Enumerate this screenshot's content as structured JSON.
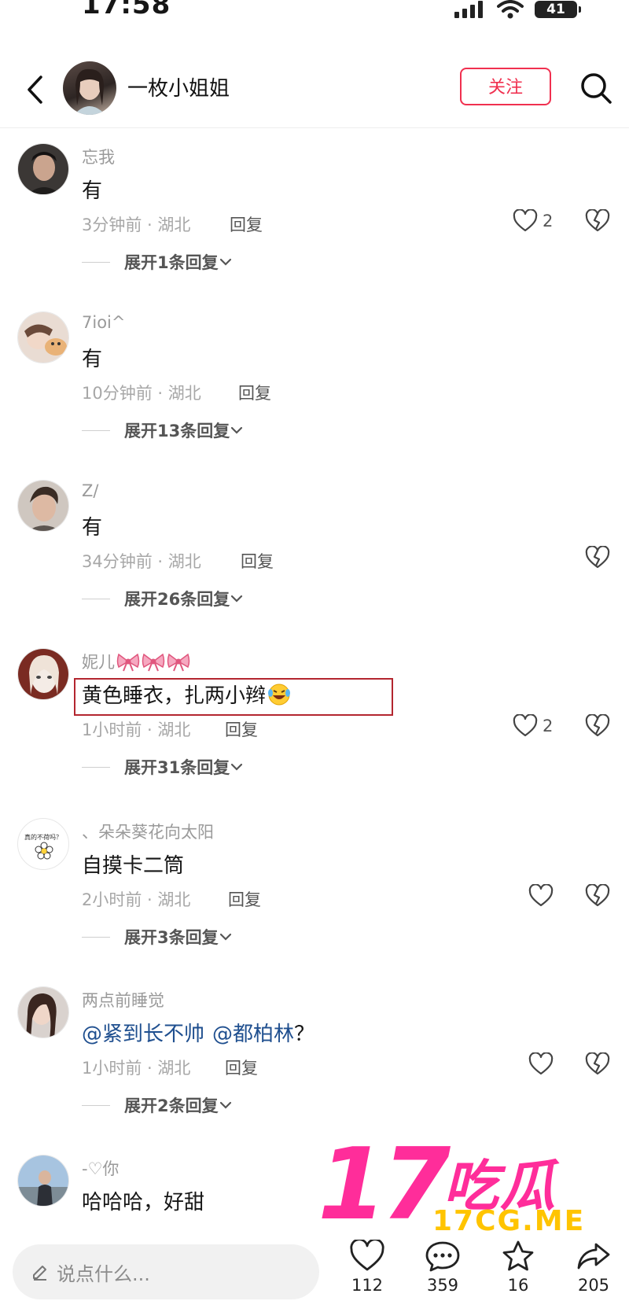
{
  "status_bar": {
    "time": "17:58",
    "battery": "41"
  },
  "header": {
    "title": "一枚小姐姐",
    "follow_label": "关注"
  },
  "comments": [
    {
      "user": "忘我",
      "text": "有",
      "time_location": "3分钟前 · 湖北",
      "reply_label": "回复",
      "likes": "2",
      "expand": "展开1条回复"
    },
    {
      "user": "7ioi^",
      "text": "有",
      "time_location": "10分钟前 · 湖北",
      "reply_label": "回复",
      "likes": "",
      "expand": "展开13条回复"
    },
    {
      "user": "Z/",
      "text": "有",
      "time_location": "34分钟前 · 湖北",
      "reply_label": "回复",
      "likes": "",
      "expand": "展开26条回复"
    },
    {
      "user": "妮儿",
      "text": "黄色睡衣，扎两小辫",
      "time_location": "1小时前 · 湖北",
      "reply_label": "回复",
      "likes": "2",
      "expand": "展开31条回复"
    },
    {
      "user": "、朵朵葵花向太阳",
      "avatar_text": "真的不荷吗？",
      "text": "自摸卡二筒",
      "time_location": "2小时前 · 湖北",
      "reply_label": "回复",
      "likes": "",
      "expand": "展开3条回复"
    },
    {
      "user": "两点前睡觉",
      "text_mention1": "@紧到长不帅",
      "text_mention2": "@都柏林",
      "text_suffix": "？",
      "time_location": "1小时前 · 湖北",
      "reply_label": "回复",
      "likes": "",
      "expand": "展开2条回复"
    },
    {
      "user": "-♡你",
      "text": "哈哈哈，好甜"
    }
  ],
  "watermark": {
    "number": "17",
    "chinese": "吃瓜",
    "url": "17CG.ME"
  },
  "bottom_bar": {
    "input_placeholder": "说点什么...",
    "like_count": "112",
    "comment_count": "359",
    "star_count": "16",
    "share_count": "205"
  },
  "colors": {
    "accent": "#f0304f",
    "mention": "#1f4f8f",
    "highlight": "#b3262f",
    "watermark_pink": "#ff2d9a",
    "watermark_yellow": "#ffc400"
  }
}
